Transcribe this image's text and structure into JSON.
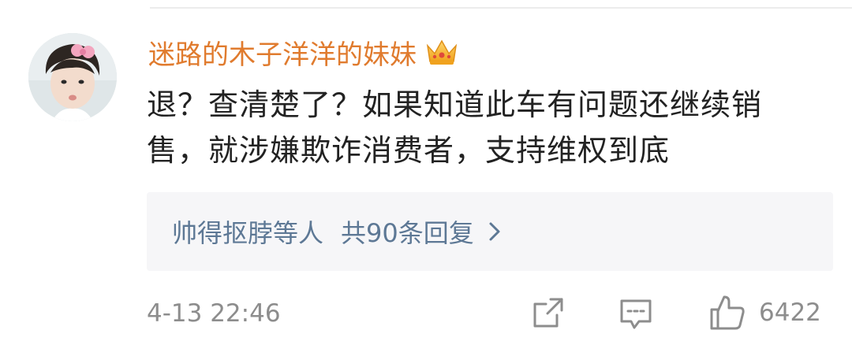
{
  "comment": {
    "username": "迷路的木子洋洋的妹妹",
    "badge_icon": "crown-icon",
    "text": "退？查清楚了？如果知道此车有问题还继续销售，就涉嫌欺诈消费者，支持维权到底",
    "replies": {
      "repliers": "帅得抠脖等人",
      "count_label": "共90条回复",
      "chevron_icon": "chevron-right-icon"
    },
    "timestamp": "4-13 22:46",
    "actions": {
      "share_icon": "share-icon",
      "comment_icon": "comment-icon",
      "like_icon": "thumbs-up-icon",
      "like_count": "6422"
    }
  },
  "colors": {
    "username": "#e07b2e",
    "text": "#222222",
    "reply_link": "#5d7895",
    "meta": "#8d8d8d",
    "reply_bg": "#f6f6f8"
  }
}
